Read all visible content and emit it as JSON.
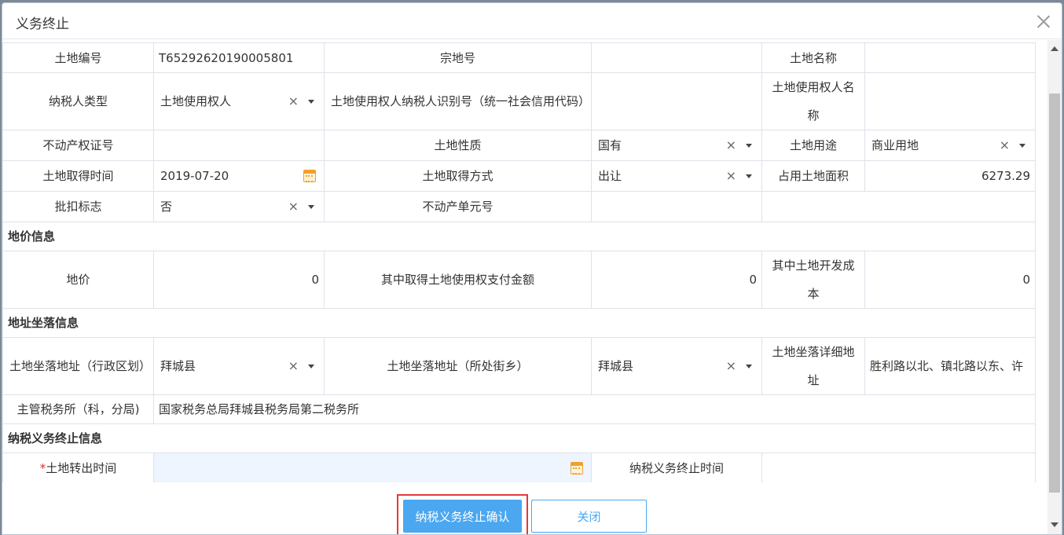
{
  "dialog": {
    "title": "义务终止",
    "close_icon": "close-icon"
  },
  "fields": {
    "land_no_label": "土地编号",
    "land_no_value": "T65292620190005801",
    "parcel_no_label": "宗地号",
    "parcel_no_value": "",
    "land_name_label": "土地名称",
    "land_name_value": "",
    "taxpayer_type_label": "纳税人类型",
    "taxpayer_type_value": "土地使用权人",
    "taxpayer_id_label": "土地使用权人纳税人识别号（统一社会信用代码）",
    "taxpayer_id_value": "",
    "owner_name_label": "土地使用权人名称",
    "owner_name_value": "",
    "cert_no_label": "不动产权证号",
    "cert_no_value": "",
    "land_nature_label": "土地性质",
    "land_nature_value": "国有",
    "land_use_label": "土地用途",
    "land_use_value": "商业用地",
    "acq_time_label": "土地取得时间",
    "acq_time_value": "2019-07-20",
    "acq_method_label": "土地取得方式",
    "acq_method_value": "出让",
    "area_label": "占用土地面积",
    "area_value": "6273.29",
    "withhold_label": "批扣标志",
    "withhold_value": "否",
    "unit_no_label": "不动产单元号",
    "unit_no_value": ""
  },
  "price_section": {
    "title": "地价信息",
    "price_label": "地价",
    "price_value": "0",
    "acq_pay_label": "其中取得土地使用权支付金额",
    "acq_pay_value": "0",
    "dev_cost_label": "其中土地开发成本",
    "dev_cost_value": "0"
  },
  "address_section": {
    "title": "地址坐落信息",
    "admin_label": "土地坐落地址（行政区划）",
    "admin_value": "拜城县",
    "street_label": "土地坐落地址（所处街乡）",
    "street_value": "拜城县",
    "detail_label": "土地坐落详细地址",
    "detail_value": "胜利路以北、镇北路以东、许",
    "tax_office_label": "主管税务所（科，分局)",
    "tax_office_value": "国家税务总局拜城县税务局第二税务所"
  },
  "termination_section": {
    "title": "纳税义务终止信息",
    "required_mark": "*",
    "transfer_time_label": "土地转出时间",
    "transfer_time_value": "",
    "end_time_label": "纳税义务终止时间",
    "end_time_value": ""
  },
  "buttons": {
    "confirm_label": "纳税义务终止确认",
    "close_label": "关闭"
  },
  "colors": {
    "primary": "#4aa7f0",
    "highlight_border": "#e8383a",
    "required": "#e02b2b",
    "calendar": "#f0a02c"
  }
}
